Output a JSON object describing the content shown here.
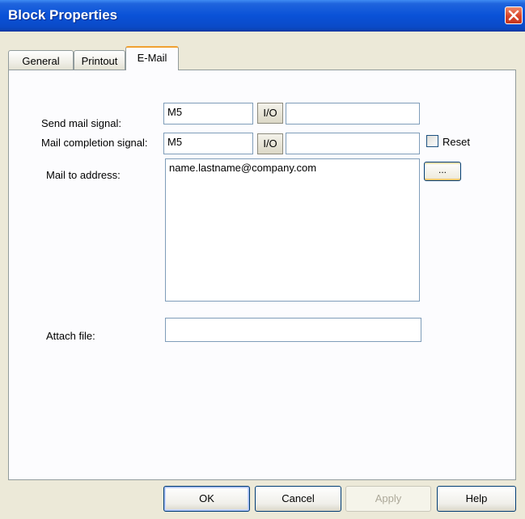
{
  "window": {
    "title": "Block Properties"
  },
  "tabs": [
    {
      "label": "General",
      "active": false
    },
    {
      "label": "Printout",
      "active": false
    },
    {
      "label": "E-Mail",
      "active": true
    }
  ],
  "form": {
    "send_mail_signal": {
      "label": "Send mail signal:",
      "value": "M5",
      "io_label": "I/O",
      "extra": ""
    },
    "mail_completion_signal": {
      "label": "Mail completion signal:",
      "value": "M5",
      "io_label": "I/O",
      "extra": ""
    },
    "reset": {
      "label": "Reset",
      "checked": false
    },
    "mail_to": {
      "label": "Mail to address:",
      "value": "name.lastname@company.com",
      "browse_label": "..."
    },
    "attach_file": {
      "label": "Attach file:",
      "value": ""
    }
  },
  "buttons": {
    "ok": "OK",
    "cancel": "Cancel",
    "apply": "Apply",
    "help": "Help"
  },
  "icons": {
    "close": "close-icon"
  },
  "colors": {
    "titlebar": "#0a52d8",
    "close": "#d9442a",
    "dialog_bg": "#ece9d8",
    "panel_bg": "#fcfcfe",
    "active_tab_accent": "#f0a030"
  }
}
